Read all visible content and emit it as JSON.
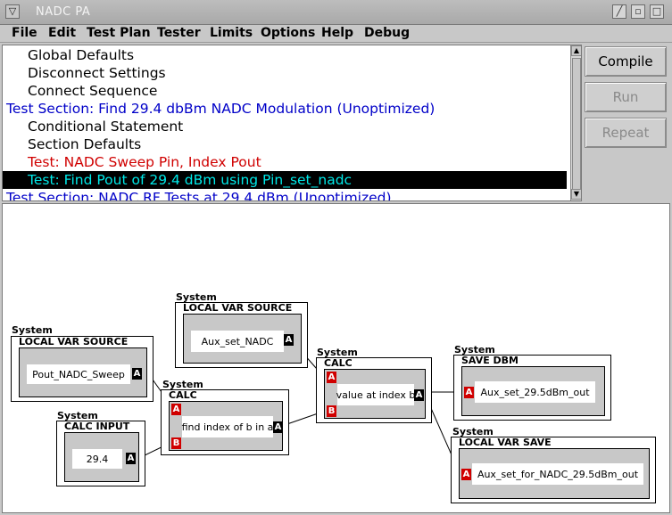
{
  "window": {
    "title": "NADC PA",
    "sysmenu_icon": "menu-triangle",
    "controls": [
      "minimize-icon",
      "maximize-icon",
      "close-icon"
    ]
  },
  "menubar": {
    "items": [
      {
        "label": "File"
      },
      {
        "label": "Edit"
      },
      {
        "label": "Test Plan"
      },
      {
        "label": "Tester"
      },
      {
        "label": "Limits"
      },
      {
        "label": "Options"
      },
      {
        "label": "Help"
      },
      {
        "label": "Debug"
      }
    ]
  },
  "test_list": {
    "rows": [
      {
        "text": "Global Defaults",
        "style": "item"
      },
      {
        "text": "Disconnect Settings",
        "style": "item"
      },
      {
        "text": "Connect Sequence",
        "style": "item"
      },
      {
        "text": "Test Section: Find 29.4 dbBm NADC Modulation (Unoptimized)",
        "style": "section"
      },
      {
        "text": "Conditional Statement",
        "style": "item"
      },
      {
        "text": "Section Defaults",
        "style": "item"
      },
      {
        "text": "Test: NADC Sweep Pin, Index Pout",
        "style": "test"
      },
      {
        "text": "Test: Find Pout of 29.4 dBm using Pin_set_nadc",
        "style": "selected"
      },
      {
        "text": "Test Section: NADC RF Tests at 29.4 dBm (Unoptimized)",
        "style": "section"
      }
    ]
  },
  "buttons": {
    "compile": "Compile",
    "run": "Run",
    "repeat": "Repeat"
  },
  "diagram": {
    "system_label": "System",
    "nodes": {
      "local_var_source_1": {
        "title": "LOCAL VAR SOURCE",
        "field": "Pout_NADC_Sweep",
        "ports_out": [
          "A"
        ]
      },
      "calc_input": {
        "title": "CALC INPUT",
        "field": "29.4",
        "ports_out": [
          "A"
        ]
      },
      "calc_1": {
        "title": "CALC",
        "field": "find index of b in a",
        "ports_in": [
          "A",
          "B"
        ],
        "ports_out": [
          "A"
        ]
      },
      "local_var_source_2": {
        "title": "LOCAL VAR SOURCE",
        "field": "Aux_set_NADC",
        "ports_out": [
          "A"
        ]
      },
      "calc_2": {
        "title": "CALC",
        "field": "value at index b",
        "ports_in": [
          "A",
          "B"
        ],
        "ports_out": [
          "A"
        ]
      },
      "save_dbm": {
        "title": "SAVE DBM",
        "field": "Aux_set_29.5dBm_out",
        "ports_in": [
          "A"
        ]
      },
      "local_var_save": {
        "title": "LOCAL VAR SAVE",
        "field": "Aux_set_for_NADC_29.5dBm_out",
        "ports_in": [
          "A"
        ]
      }
    }
  }
}
